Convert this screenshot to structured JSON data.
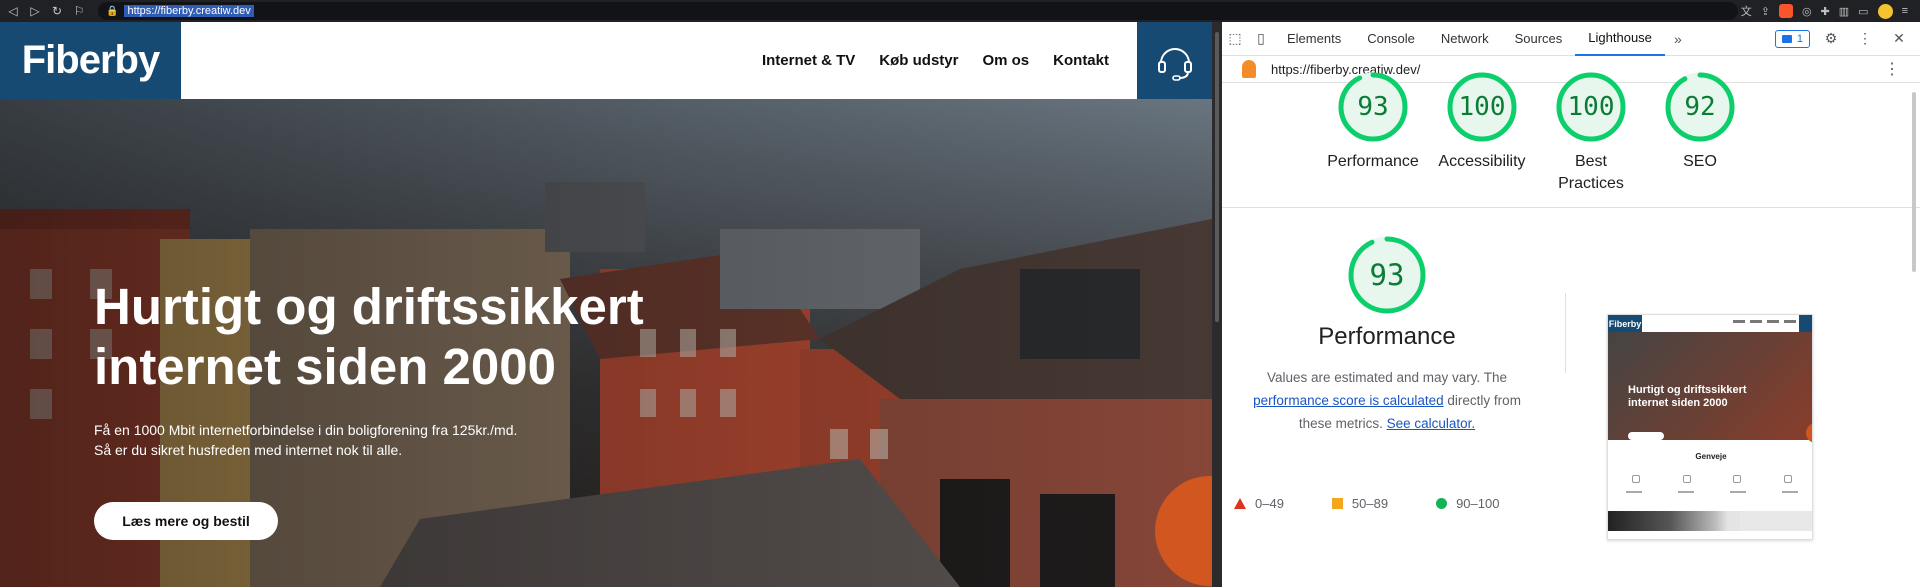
{
  "browser": {
    "url": "https://fiberby.creatiw.dev"
  },
  "site": {
    "logo": "Fiberby",
    "nav": [
      "Internet & TV",
      "Køb udstyr",
      "Om os",
      "Kontakt"
    ],
    "hero": {
      "title_line1": "Hurtigt og driftssikkert",
      "title_line2": "internet siden 2000",
      "sub_line1": "Få en 1000 Mbit internetforbindelse i din boligforening fra 125kr./md.",
      "sub_line2": "Så er du sikret husfreden med internet nok til alle.",
      "button": "Læs mere og bestil"
    }
  },
  "devtools": {
    "tabs": [
      "Elements",
      "Console",
      "Network",
      "Sources",
      "Lighthouse"
    ],
    "active_tab": "Lighthouse",
    "issues_count": "1",
    "lighthouse_url": "https://fiberby.creatiw.dev/",
    "scores": [
      {
        "value": 93,
        "label": "Performance"
      },
      {
        "value": 100,
        "label": "Accessibility"
      },
      {
        "value": 100,
        "label": "Best Practices"
      },
      {
        "value": 92,
        "label": "SEO"
      }
    ],
    "performance": {
      "score": 93,
      "title": "Performance",
      "desc_part1": "Values are estimated and may vary. The",
      "desc_link1": "performance score is calculated",
      "desc_part2": "directly from these metrics.",
      "desc_link2": "See calculator.",
      "legend": [
        "0–49",
        "50–89",
        "90–100"
      ]
    },
    "thumbnail": {
      "logo": "Fiberby",
      "title_line1": "Hurtigt og driftssikkert",
      "title_line2": "internet siden 2000",
      "section": "Genveje"
    }
  },
  "colors": {
    "brand_blue": "#174a73",
    "score_good": "#0cce6b",
    "orange": "#d2561f"
  }
}
